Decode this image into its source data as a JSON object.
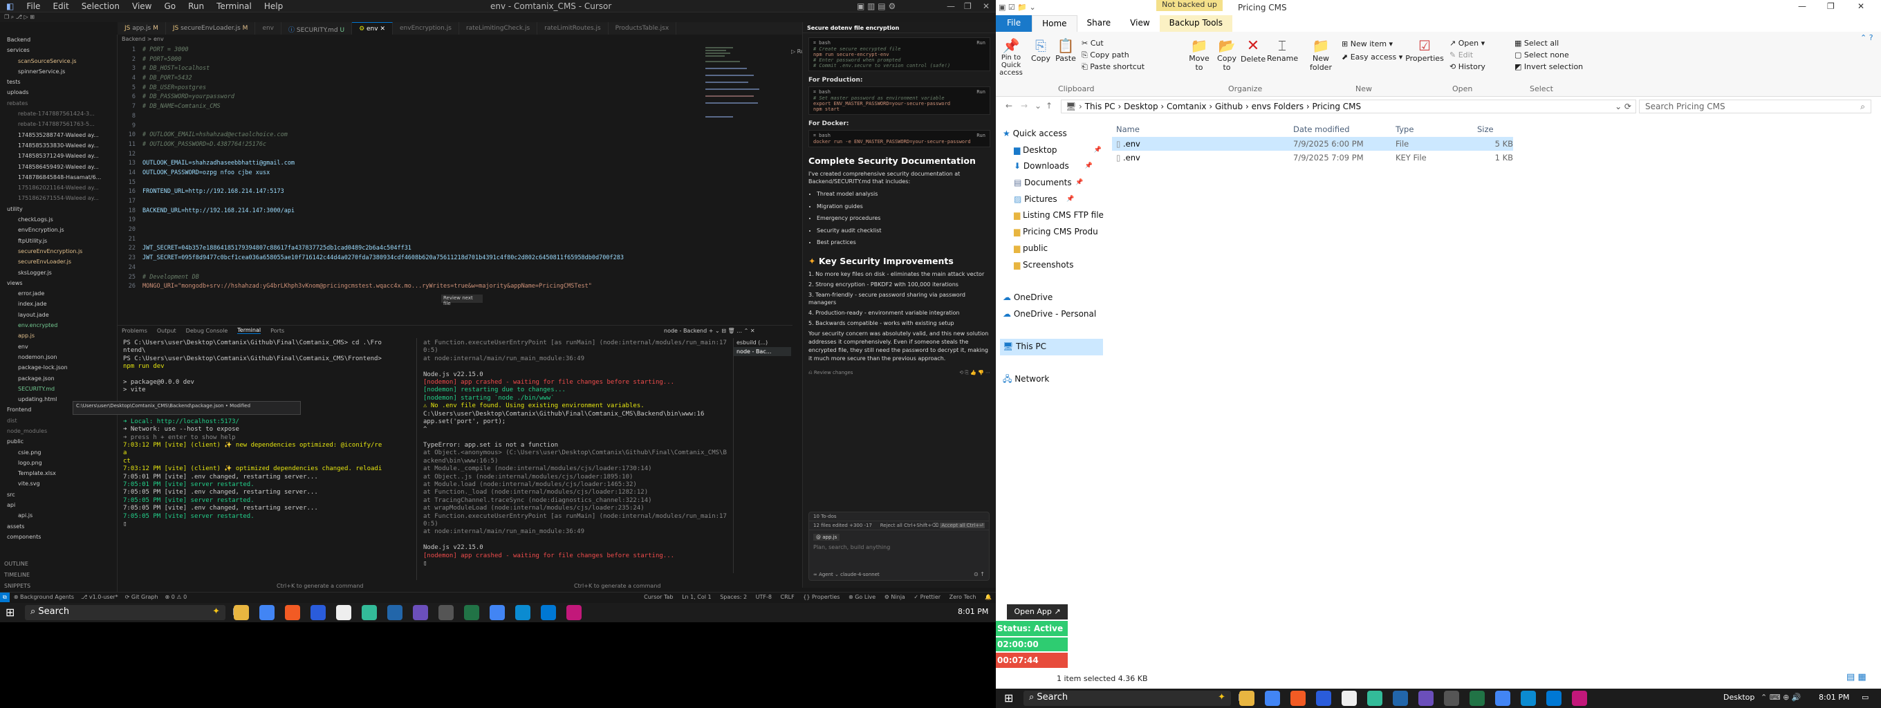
{
  "cursor": {
    "menu": [
      "File",
      "Edit",
      "Selection",
      "View",
      "Go",
      "Run",
      "Terminal",
      "Help"
    ],
    "title": "env - Comtanix_CMS - Cursor",
    "tabs": [
      {
        "label": "app.js",
        "badge": "M"
      },
      {
        "label": "secureEnvLoader.js",
        "badge": "M"
      },
      {
        "label": "env",
        "badge": ""
      },
      {
        "label": "SECURITY.md",
        "badge": "U"
      },
      {
        "label": "env",
        "badge": ""
      },
      {
        "label": "envEncryption.js",
        "badge": ""
      },
      {
        "label": "rateLimitingCheck.js",
        "badge": ""
      },
      {
        "label": "rateLimitRoutes.js",
        "badge": ""
      },
      {
        "label": "ProductsTable.jsx",
        "badge": ""
      }
    ],
    "breadcrumb": "Backend > env",
    "sidebar_tree": [
      {
        "t": "Backend",
        "c": ""
      },
      {
        "t": "services",
        "c": ""
      },
      {
        "t": "scanSourceService.js",
        "c": "m"
      },
      {
        "t": "spinnerService.js",
        "c": ""
      },
      {
        "t": "tests",
        "c": ""
      },
      {
        "t": "uploads",
        "c": ""
      },
      {
        "t": "rebates",
        "c": "d"
      },
      {
        "t": "rebate-1747887561424-3...",
        "c": "d"
      },
      {
        "t": "rebate-1747887561763-5...",
        "c": "d"
      },
      {
        "t": "1748535288747-Waleed ay...",
        "c": ""
      },
      {
        "t": "1748585353830-Waleed ay...",
        "c": ""
      },
      {
        "t": "1748585371249-Waleed ay...",
        "c": ""
      },
      {
        "t": "1748586459492-Waleed ay...",
        "c": ""
      },
      {
        "t": "1748786845848-Hasamat/6...",
        "c": ""
      },
      {
        "t": "1751862021164-Waleed ay...",
        "c": "d"
      },
      {
        "t": "1751862671554-Waleed ay...",
        "c": "d"
      },
      {
        "t": "utility",
        "c": ""
      },
      {
        "t": "checkLogs.js",
        "c": ""
      },
      {
        "t": "envEncryption.js",
        "c": ""
      },
      {
        "t": "ftpUtility.js",
        "c": ""
      },
      {
        "t": "secureEnvEncryption.js",
        "c": "m"
      },
      {
        "t": "secureEnvLoader.js",
        "c": "m"
      },
      {
        "t": "sksLogger.js",
        "c": ""
      },
      {
        "t": "views",
        "c": ""
      },
      {
        "t": "error.jade",
        "c": ""
      },
      {
        "t": "index.jade",
        "c": ""
      },
      {
        "t": "layout.jade",
        "c": ""
      },
      {
        "t": "env.encrypted",
        "c": "g"
      },
      {
        "t": "app.js",
        "c": "m"
      },
      {
        "t": "env",
        "c": ""
      },
      {
        "t": "nodemon.json",
        "c": ""
      },
      {
        "t": "package-lock.json",
        "c": ""
      },
      {
        "t": "package.json",
        "c": ""
      },
      {
        "t": "SECURITY.md",
        "c": "g"
      },
      {
        "t": "updating.html",
        "c": ""
      },
      {
        "t": "Frontend",
        "c": ""
      },
      {
        "t": "dist",
        "c": "d"
      },
      {
        "t": "node_modules",
        "c": "d"
      },
      {
        "t": "public",
        "c": ""
      },
      {
        "t": "csie.png",
        "c": ""
      },
      {
        "t": "logo.png",
        "c": ""
      },
      {
        "t": "Template.xlsx",
        "c": ""
      },
      {
        "t": "vite.svg",
        "c": ""
      },
      {
        "t": "src",
        "c": ""
      },
      {
        "t": "api",
        "c": ""
      },
      {
        "t": "api.js",
        "c": ""
      },
      {
        "t": "assets",
        "c": ""
      },
      {
        "t": "components",
        "c": ""
      }
    ],
    "sidebar_bottom": [
      "OUTLINE",
      "TIMELINE",
      "SNIPPETS"
    ],
    "code_lines": [
      {
        "n": "1",
        "t": "# PORT = 3000",
        "k": "cm"
      },
      {
        "n": "2",
        "t": "# PORT=5000",
        "k": "cm"
      },
      {
        "n": "3",
        "t": "# DB_HOST=localhost",
        "k": "cm"
      },
      {
        "n": "4",
        "t": "# DB_PORT=5432",
        "k": "cm"
      },
      {
        "n": "5",
        "t": "# DB_USER=postgres",
        "k": "cm"
      },
      {
        "n": "6",
        "t": "# DB_PASSWORD=yourpassword",
        "k": "cm"
      },
      {
        "n": "7",
        "t": "# DB_NAME=Comtanix_CMS",
        "k": "cm"
      },
      {
        "n": "8",
        "t": "",
        "k": ""
      },
      {
        "n": "9",
        "t": "",
        "k": ""
      },
      {
        "n": "10",
        "t": "# OUTLOOK_EMAIL=hshahzad@ectaolchoice.com",
        "k": "cm"
      },
      {
        "n": "11",
        "t": "# OUTLOOK_PASSWORD=D.4387764!25176c",
        "k": "cm"
      },
      {
        "n": "12",
        "t": "",
        "k": ""
      },
      {
        "n": "13",
        "t": "OUTLOOK_EMAIL=shahzadhaseebbhatti@gmail.com",
        "k": "cv"
      },
      {
        "n": "14",
        "t": "OUTLOOK_PASSWORD=ozpg nfoo cjbe xusx",
        "k": "cv"
      },
      {
        "n": "15",
        "t": "",
        "k": ""
      },
      {
        "n": "16",
        "t": "FRONTEND_URL=http://192.168.214.147:5173",
        "k": "cv"
      },
      {
        "n": "17",
        "t": "",
        "k": ""
      },
      {
        "n": "18",
        "t": "BACKEND_URL=http://192.168.214.147:3000/api",
        "k": "cv"
      },
      {
        "n": "19",
        "t": "",
        "k": ""
      },
      {
        "n": "20",
        "t": "",
        "k": ""
      },
      {
        "n": "21",
        "t": "",
        "k": ""
      },
      {
        "n": "22",
        "t": "JWT_SECRET=04b357e18864185179394807c88617fa437837725db1cad0489c2b6a4c504ff31",
        "k": "cv"
      },
      {
        "n": "23",
        "t": "JWT_SECRET=095f8d9477c0bcf1cea036a658055ae10f716142c44d4a0270fda7380934cdf4608b620a75611218d701b4391c4f80c2d802c6450811f65958db0d700f283",
        "k": "cv"
      },
      {
        "n": "24",
        "t": "",
        "k": ""
      },
      {
        "n": "25",
        "t": "# Development DB",
        "k": "cm"
      },
      {
        "n": "26",
        "t": "MONGO_URI=\"mongodb+srv://hshahzad:yG4brLKhph3vKnom@pricingcmstest.wqacc4x.mo...ryWrites=true&w=majority&appName=PricingCMSTest\"",
        "k": "cs"
      }
    ],
    "review_hint": "Review next file",
    "panel_tabs": [
      "Problems",
      "Output",
      "Debug Console",
      "Terminal",
      "Ports"
    ],
    "term_selector": "node - Backend",
    "term_left": [
      {
        "t": "PS C:\\Users\\user\\Desktop\\Comtanix\\Github\\Final\\Comtanix_CMS> cd .\\Fro",
        "c": ""
      },
      {
        "t": "ntend\\",
        "c": ""
      },
      {
        "t": "PS C:\\Users\\user\\Desktop\\Comtanix\\Github\\Final\\Comtanix_CMS\\Frontend>",
        "c": ""
      },
      {
        "t": "  npm run dev",
        "c": "tyel"
      },
      {
        "t": "",
        "c": ""
      },
      {
        "t": "> package@0.0.0 dev",
        "c": ""
      },
      {
        "t": "> vite",
        "c": ""
      },
      {
        "t": "",
        "c": ""
      },
      {
        "t": "",
        "c": ""
      },
      {
        "t": "",
        "c": ""
      },
      {
        "t": "  ➜  Local:   http://localhost:5173/",
        "c": "tgreen"
      },
      {
        "t": "  ➜  Network: use --host to expose",
        "c": ""
      },
      {
        "t": "  ➜  press h + enter to show help",
        "c": "tgray"
      },
      {
        "t": "7:03:12 PM [vite] (client) ✨ new dependencies optimized: @iconify/re",
        "c": "tyel"
      },
      {
        "t": "a",
        "c": "tyel"
      },
      {
        "t": "ct",
        "c": "tyel"
      },
      {
        "t": "7:03:12 PM [vite] (client) ✨ optimized dependencies changed. reloadi",
        "c": "tyel"
      },
      {
        "t": "7:05:01 PM [vite] .env changed, restarting server...",
        "c": ""
      },
      {
        "t": "7:05:01 PM [vite] server restarted.",
        "c": "tgreen"
      },
      {
        "t": "7:05:05 PM [vite] .env changed, restarting server...",
        "c": ""
      },
      {
        "t": "7:05:05 PM [vite] server restarted.",
        "c": "tgreen"
      },
      {
        "t": "7:05:05 PM [vite] .env changed, restarting server...",
        "c": ""
      },
      {
        "t": "7:05:05 PM [vite] server restarted.",
        "c": "tgreen"
      },
      {
        "t": "▯",
        "c": ""
      }
    ],
    "term_right": [
      {
        "t": "    at Function.executeUserEntryPoint [as runMain] (node:internal/modules/run_main:17",
        "c": "tgray"
      },
      {
        "t": "0:5)",
        "c": "tgray"
      },
      {
        "t": "    at node:internal/main/run_main_module:36:49",
        "c": "tgray"
      },
      {
        "t": "",
        "c": ""
      },
      {
        "t": "Node.js v22.15.0",
        "c": ""
      },
      {
        "t": "[nodemon] app crashed - waiting for file changes before starting...",
        "c": "tred"
      },
      {
        "t": "[nodemon] restarting due to changes...",
        "c": "tgreen"
      },
      {
        "t": "[nodemon] starting `node ./bin/www`",
        "c": "tgreen"
      },
      {
        "t": "⚠ No .env file found. Using existing environment variables.",
        "c": "tyel"
      },
      {
        "t": "C:\\Users\\user\\Desktop\\Comtanix\\Github\\Final\\Comtanix_CMS\\Backend\\bin\\www:16",
        "c": ""
      },
      {
        "t": "app.set('port', port);",
        "c": ""
      },
      {
        "t": "    ^",
        "c": ""
      },
      {
        "t": "",
        "c": ""
      },
      {
        "t": "TypeError: app.set is not a function",
        "c": ""
      },
      {
        "t": "    at Object.<anonymous> (C:\\Users\\user\\Desktop\\Comtanix\\Github\\Final\\Comtanix_CMS\\B",
        "c": "tgray"
      },
      {
        "t": "ackend\\bin\\www:16:5)",
        "c": "tgray"
      },
      {
        "t": "    at Module._compile (node:internal/modules/cjs/loader:1730:14)",
        "c": "tgray"
      },
      {
        "t": "    at Object..js (node:internal/modules/cjs/loader:1895:10)",
        "c": "tgray"
      },
      {
        "t": "    at Module.load (node:internal/modules/cjs/loader:1465:32)",
        "c": "tgray"
      },
      {
        "t": "    at Function._load (node:internal/modules/cjs/loader:1282:12)",
        "c": "tgray"
      },
      {
        "t": "    at TracingChannel.traceSync (node:diagnostics_channel:322:14)",
        "c": "tgray"
      },
      {
        "t": "    at wrapModuleLoad (node:internal/modules/cjs/loader:235:24)",
        "c": "tgray"
      },
      {
        "t": "    at Function.executeUserEntryPoint [as runMain] (node:internal/modules/run_main:17",
        "c": "tgray"
      },
      {
        "t": "0:5)",
        "c": "tgray"
      },
      {
        "t": "    at node:internal/main/run_main_module:36:49",
        "c": "tgray"
      },
      {
        "t": "",
        "c": ""
      },
      {
        "t": "Node.js v22.15.0",
        "c": ""
      },
      {
        "t": "[nodemon] app crashed - waiting for file changes before starting...",
        "c": "tred"
      },
      {
        "t": "▯",
        "c": ""
      }
    ],
    "term_sessions": [
      "esbuild (...)",
      "node - Bac..."
    ],
    "term_hint": "Ctrl+K to generate a command",
    "tooltip_path": "C:\\Users\\user\\Desktop\\Comtanix_CMS\\Backend\\package.json • Modified",
    "chat": {
      "title": "Secure dotenv file encryption",
      "code1": [
        "# Create secure encrypted file",
        "npm run secure-encrypt-env",
        "# Enter password when prompted",
        "# Commit .env.secure to version control (safe!)"
      ],
      "prod_heading": "For Production:",
      "code2": [
        "# Set master password as environment variable",
        "export ENV_MASTER_PASSWORD=your-secure-password",
        "npm start"
      ],
      "docker_heading": "For Docker:",
      "code3": [
        "docker run -e ENV_MASTER_PASSWORD=your-secure-password"
      ],
      "doc_heading": "Complete Security Documentation",
      "doc_text": "I've created comprehensive security documentation at Backend/SECURITY.md that includes:",
      "doc_items": [
        "Threat model analysis",
        "Migration guides",
        "Emergency procedures",
        "Security audit checklist",
        "Best practices"
      ],
      "key_heading": "Key Security Improvements",
      "key_items": [
        "1. No more key files on disk - eliminates the main attack vector",
        "2. Strong encryption - PBKDF2 with 100,000 iterations",
        "3. Team-friendly - secure password sharing via password managers",
        "4. Production-ready - environment variable integration",
        "5. Backwards compatible - works with existing setup"
      ],
      "closing": "Your security concern was absolutely valid, and this new solution addresses it comprehensively. Even if someone steals the encrypted file, they still need the password to decrypt it, making it much more secure than the previous approach.",
      "review_changes": "Review changes",
      "todos": "10 To-dos",
      "files_edited": "12 files edited +300 -17",
      "reject_all": "Reject all  Ctrl+Shift+⌫",
      "accept_all": "Accept all  Ctrl+⏎",
      "context_chip": "app.js",
      "input_placeholder": "Plan, search, build anything",
      "agent_mode": "Agent",
      "model": "claude-4-sonnet"
    },
    "status": {
      "left": [
        "⊗ Background Agents",
        "⎇ v1.0-user*",
        "⟳ Git Graph",
        "⊗ 0 ⚠ 0"
      ],
      "right": [
        "Cursor Tab",
        "Ln 1, Col 1",
        "Spaces: 2",
        "UTF-8",
        "CRLF",
        "{} Properties",
        "⊗ Go Live",
        "⚙ Ninja",
        "✓ Prettier",
        "Zero Tech",
        "🔔"
      ]
    }
  },
  "explorer": {
    "title": "Pricing CMS",
    "backup_badge": "Not backed up",
    "backup_tools": "Backup Tools",
    "menu": [
      "File",
      "Home",
      "Share",
      "View"
    ],
    "ribbon": {
      "pin": "Pin to Quick access",
      "copy": "Copy",
      "paste": "Paste",
      "cut": "Cut",
      "copy_path": "Copy path",
      "paste_shortcut": "Paste shortcut",
      "clipboard": "Clipboard",
      "move_to": "Move to",
      "copy_to": "Copy to",
      "delete": "Delete",
      "rename": "Rename",
      "organize": "Organize",
      "new_folder": "New folder",
      "new_item": "New item ▾",
      "easy_access": "Easy access ▾",
      "new_group": "New",
      "properties": "Properties",
      "open": "Open ▾",
      "edit": "Edit",
      "history": "History",
      "open_group": "Open",
      "select_all": "Select all",
      "select_none": "Select none",
      "invert_selection": "Invert selection",
      "select_group": "Select"
    },
    "path": [
      "This PC",
      "Desktop",
      "Comtanix",
      "Github",
      "envs Folders",
      "Pricing CMS"
    ],
    "search_placeholder": "Search Pricing CMS",
    "nav": [
      {
        "t": "Quick access",
        "i": "star",
        "pin": false
      },
      {
        "t": "Desktop",
        "i": "folder-blue",
        "pin": true
      },
      {
        "t": "Downloads",
        "i": "download",
        "pin": true
      },
      {
        "t": "Documents",
        "i": "doc",
        "pin": true
      },
      {
        "t": "Pictures",
        "i": "picture",
        "pin": true
      },
      {
        "t": "Listing CMS FTP file",
        "i": "folder",
        "pin": false
      },
      {
        "t": "Pricing CMS Produ",
        "i": "folder",
        "pin": false
      },
      {
        "t": "public",
        "i": "folder",
        "pin": false
      },
      {
        "t": "Screenshots",
        "i": "folder",
        "pin": false
      },
      {
        "t": "",
        "i": "",
        "pin": false
      },
      {
        "t": "OneDrive",
        "i": "cloud",
        "pin": false
      },
      {
        "t": "OneDrive - Personal",
        "i": "cloud",
        "pin": false
      },
      {
        "t": "",
        "i": "",
        "pin": false
      },
      {
        "t": "This PC",
        "i": "pc",
        "pin": false
      },
      {
        "t": "",
        "i": "",
        "pin": false
      },
      {
        "t": "Network",
        "i": "network",
        "pin": false
      }
    ],
    "columns": [
      "Name",
      "Date modified",
      "Type",
      "Size"
    ],
    "files": [
      {
        "name": ".env",
        "date": "7/9/2025 6:00 PM",
        "type": "File",
        "size": "5 KB",
        "selected": true
      },
      {
        "name": ".env",
        "date": "7/9/2025 7:09 PM",
        "type": "KEY File",
        "size": "1 KB",
        "selected": false
      }
    ],
    "status_text": "1 item selected  4.36 KB"
  },
  "widget": {
    "open_app": "Open App ↗",
    "status": "Status: Active",
    "timer1": "02:00:00",
    "timer2": "00:07:44"
  },
  "taskbar": {
    "search": "Search",
    "time": "8:01 PM",
    "desktop_label": "Desktop",
    "time2": "8:01 PM"
  },
  "colors": {
    "accent": "#0078d4",
    "editor_bg": "#181818",
    "explorer_bg": "#ffffff",
    "widget_green": "#2ecc71",
    "widget_red": "#e74c3c"
  }
}
